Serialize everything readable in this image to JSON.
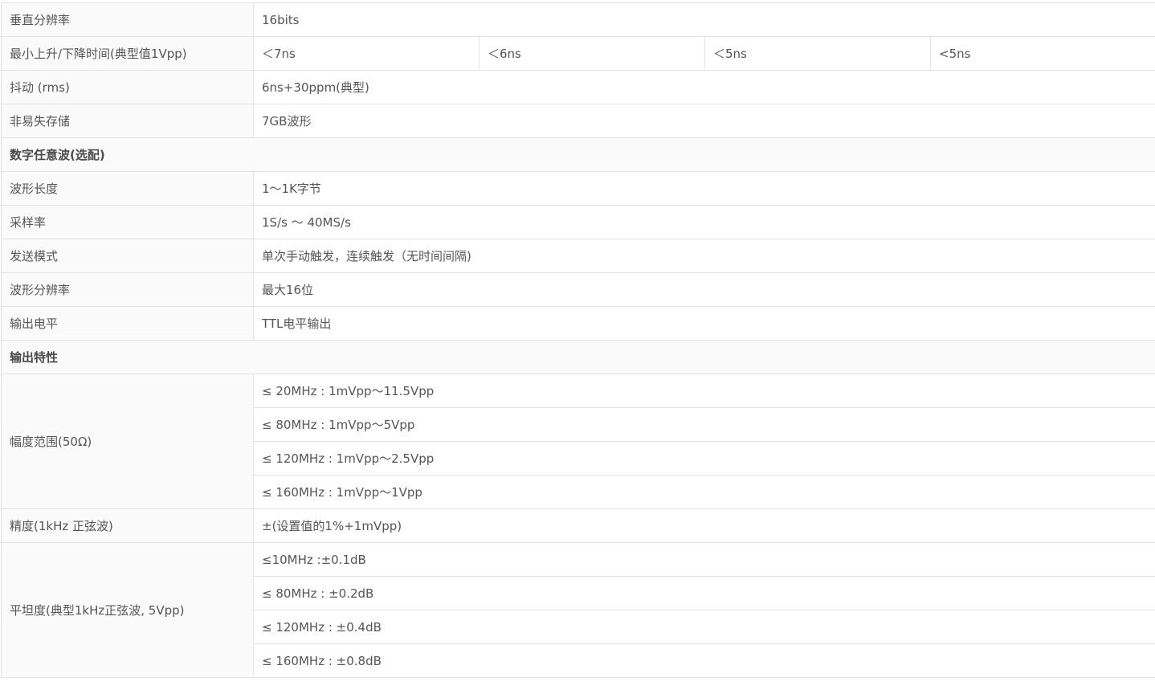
{
  "rows": {
    "vres": {
      "label": "垂直分辨率",
      "value": "16bits"
    },
    "rise": {
      "label": "最小上升/下降时间(典型值1Vpp)",
      "values": [
        "＜7ns",
        "＜6ns",
        "＜5ns",
        "<5ns"
      ]
    },
    "jitter": {
      "label": "抖动 (rms)",
      "value": "6ns+30ppm(典型)"
    },
    "nvstore": {
      "label": "非易失存储",
      "value": "7GB波形"
    }
  },
  "section_digital": {
    "title": "数字任意波(选配)",
    "rows": [
      {
        "label": "波形长度",
        "value": "1～1K字节"
      },
      {
        "label": "采样率",
        "value": "1S/s ～ 40MS/s"
      },
      {
        "label": "发送模式",
        "value": "单次手动触发，连续触发（无时间间隔)"
      },
      {
        "label": "波形分辨率",
        "value": "最大16位"
      },
      {
        "label": "输出电平",
        "value": "TTL电平输出"
      }
    ]
  },
  "section_output": {
    "title": "输出特性",
    "amplitude": {
      "label": "幅度范围(50Ω)",
      "values": [
        "≤ 20MHz : 1mVpp～11.5Vpp",
        "≤ 80MHz : 1mVpp～5Vpp",
        "≤ 120MHz : 1mVpp～2.5Vpp",
        "≤ 160MHz : 1mVpp～1Vpp"
      ]
    },
    "accuracy": {
      "label": "精度(1kHz 正弦波)",
      "value": "±(设置值的1%+1mVpp)"
    },
    "flatness": {
      "label": "平坦度(典型1kHz正弦波, 5Vpp)",
      "values": [
        "≤10MHz :±0.1dB",
        "≤ 80MHz : ±0.2dB",
        "≤ 120MHz : ±0.4dB",
        "≤ 160MHz : ±0.8dB"
      ]
    }
  }
}
